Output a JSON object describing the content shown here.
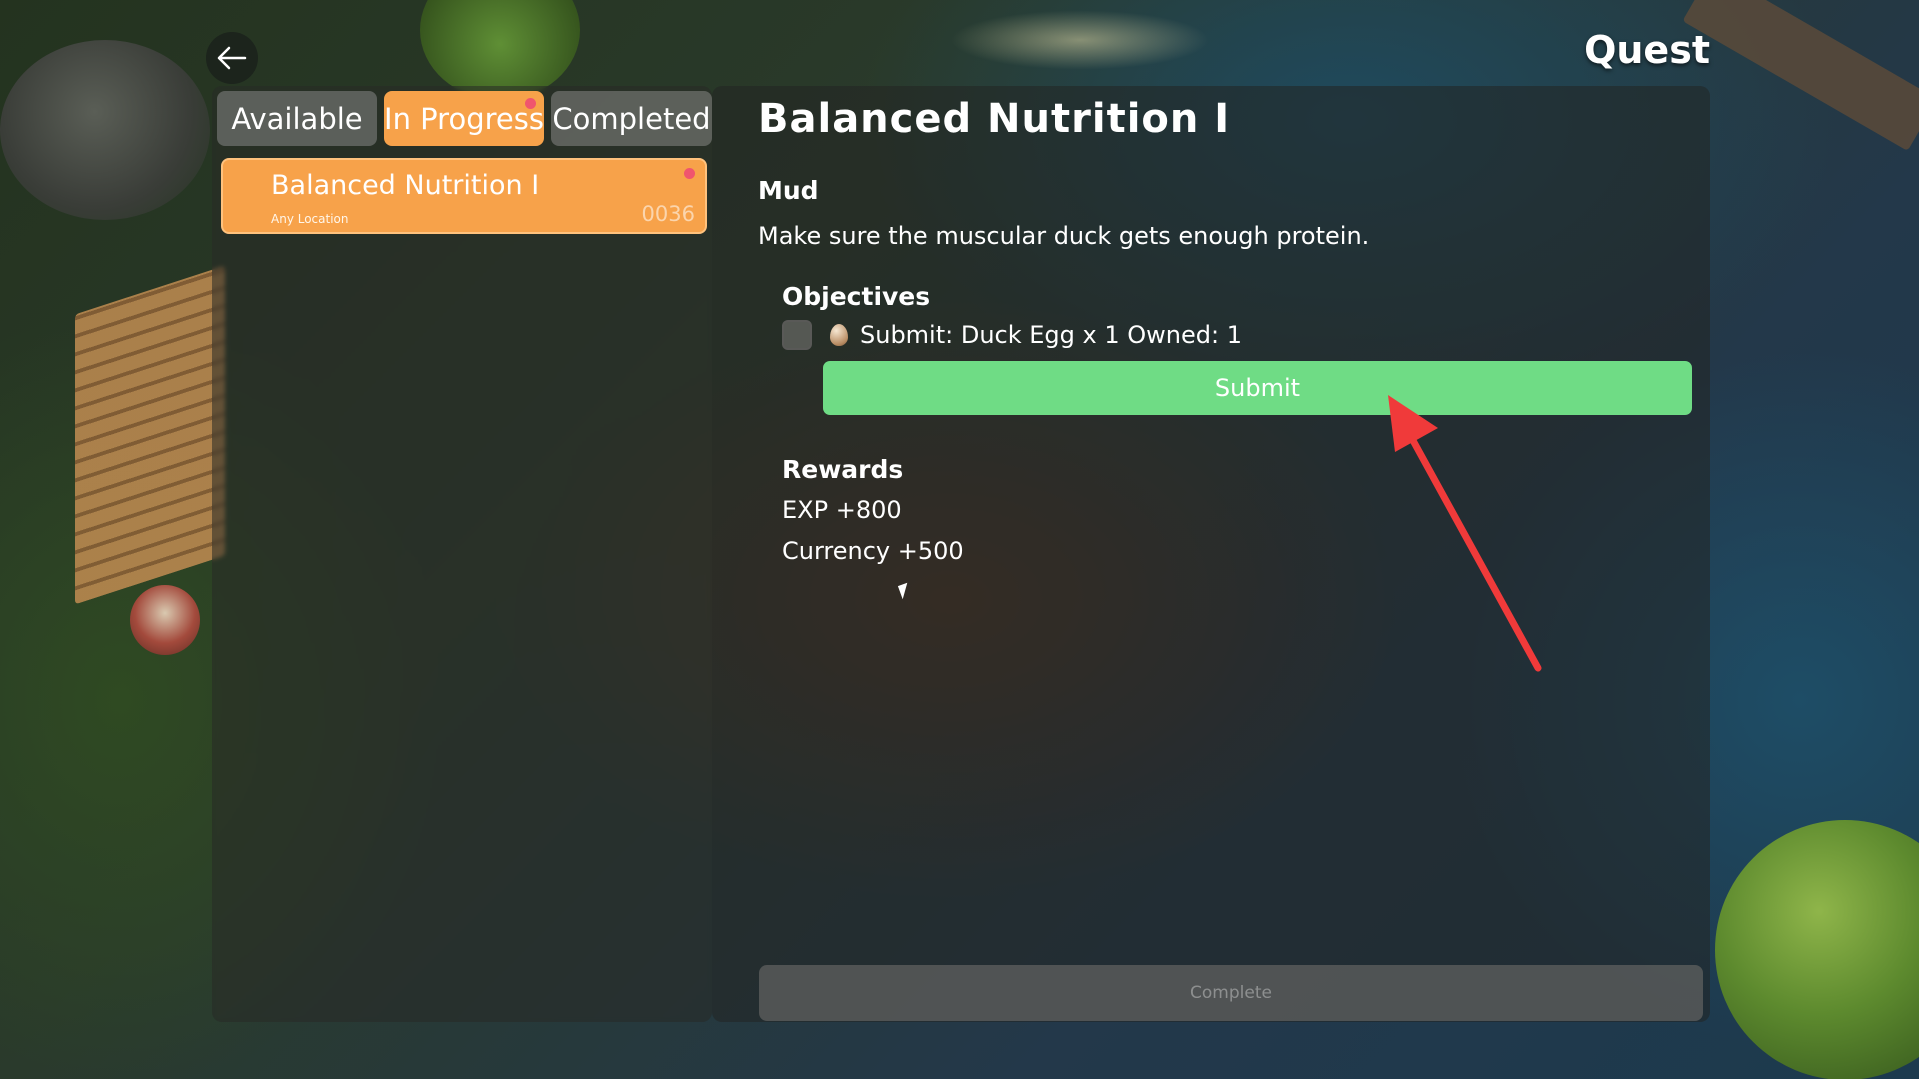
{
  "header": {
    "title": "Quest",
    "back_icon": "arrow-left-icon"
  },
  "tabs": [
    {
      "label": "Available",
      "active": false
    },
    {
      "label": "In Progress",
      "active": true,
      "has_notification": true
    },
    {
      "label": "Completed",
      "active": false
    }
  ],
  "quest_list": [
    {
      "title": "Balanced Nutrition I",
      "location": "Any Location",
      "id": "0036",
      "has_notification": true
    }
  ],
  "detail": {
    "title": "Balanced Nutrition I",
    "giver": "Mud",
    "description": "Make sure the muscular duck gets enough protein.",
    "objectives_heading": "Objectives",
    "objectives": [
      {
        "text": "Submit: Duck Egg x 1 Owned: 1",
        "icon": "duck-egg-icon",
        "checked": false
      }
    ],
    "submit_label": "Submit",
    "rewards_heading": "Rewards",
    "rewards": [
      "EXP +800",
      "Currency +500"
    ],
    "complete_label": "Complete"
  },
  "colors": {
    "accent_orange": "#f7a24a",
    "submit_green": "#6fdc85",
    "notification_red": "#f0556e",
    "annotation_arrow": "#f03a3a"
  }
}
